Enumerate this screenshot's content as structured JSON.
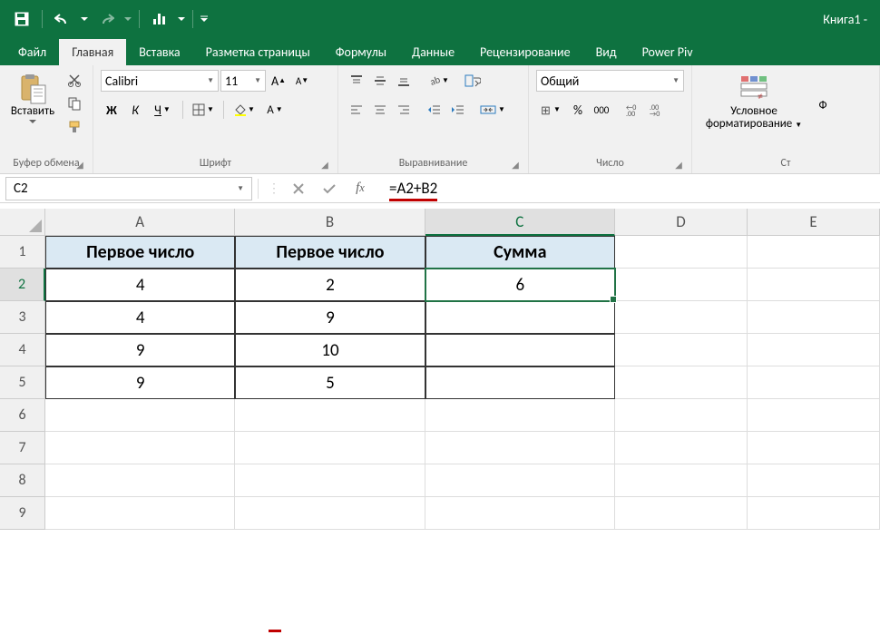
{
  "title": "Книга1 -",
  "tabs": {
    "file": "Файл",
    "home": "Главная",
    "insert": "Вставка",
    "layout": "Разметка страницы",
    "formulas": "Формулы",
    "data": "Данные",
    "review": "Рецензирование",
    "view": "Вид",
    "powerpivot": "Power Piv"
  },
  "ribbon": {
    "clipboard": {
      "paste": "Вставить",
      "label": "Буфер обмена"
    },
    "font": {
      "name": "Calibri",
      "size": "11",
      "bold": "Ж",
      "italic": "К",
      "underline": "Ч",
      "label": "Шрифт"
    },
    "alignment": {
      "label": "Выравнивание"
    },
    "number": {
      "format": "Общий",
      "label": "Число"
    },
    "styles": {
      "condfmt": "Условное форматирование",
      "label": "Ст"
    },
    "truncF": "Ф"
  },
  "namebox": "C2",
  "formula": "=A2+B2",
  "columns": [
    "A",
    "B",
    "C",
    "D",
    "E"
  ],
  "rows": [
    "1",
    "2",
    "3",
    "4",
    "5",
    "6",
    "7",
    "8",
    "9"
  ],
  "cells": {
    "A1": "Первое число",
    "B1": "Первое число",
    "C1": "Сумма",
    "A2": "4",
    "B2": "2",
    "C2": "6",
    "A3": "4",
    "B3": "9",
    "A4": "9",
    "B4": "10",
    "A5": "9",
    "B5": "5"
  }
}
